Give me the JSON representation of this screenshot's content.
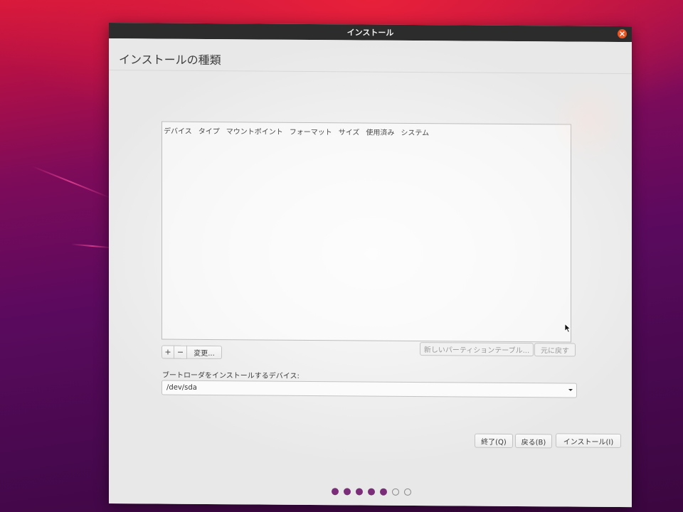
{
  "window": {
    "title": "インストール"
  },
  "page": {
    "title": "インストールの種類"
  },
  "partition_table": {
    "columns": [
      "デバイス",
      "タイプ",
      "マウントポイント",
      "フォーマット",
      "サイズ",
      "使用済み",
      "システム"
    ],
    "rows": []
  },
  "partition_actions": {
    "add_label": "+",
    "remove_label": "−",
    "change_label": "変更...",
    "new_table_label": "新しいパーティションテーブル...",
    "revert_label": "元に戻す"
  },
  "bootloader": {
    "label": "ブートローダをインストールするデバイス:",
    "selected": "/dev/sda"
  },
  "nav_buttons": {
    "quit_label": "終了(Q)",
    "back_label": "戻る(B)",
    "install_label": "インストール(I)"
  },
  "progress": {
    "total_steps": 7,
    "completed_steps": 5
  },
  "colors": {
    "titlebar": "#2c2c2c",
    "close_button": "#e95420",
    "progress_dot_done": "#7b2d7a"
  },
  "icons": {
    "close": "close-icon",
    "dropdown": "chevron-down-icon",
    "cursor": "mouse-pointer-icon"
  }
}
